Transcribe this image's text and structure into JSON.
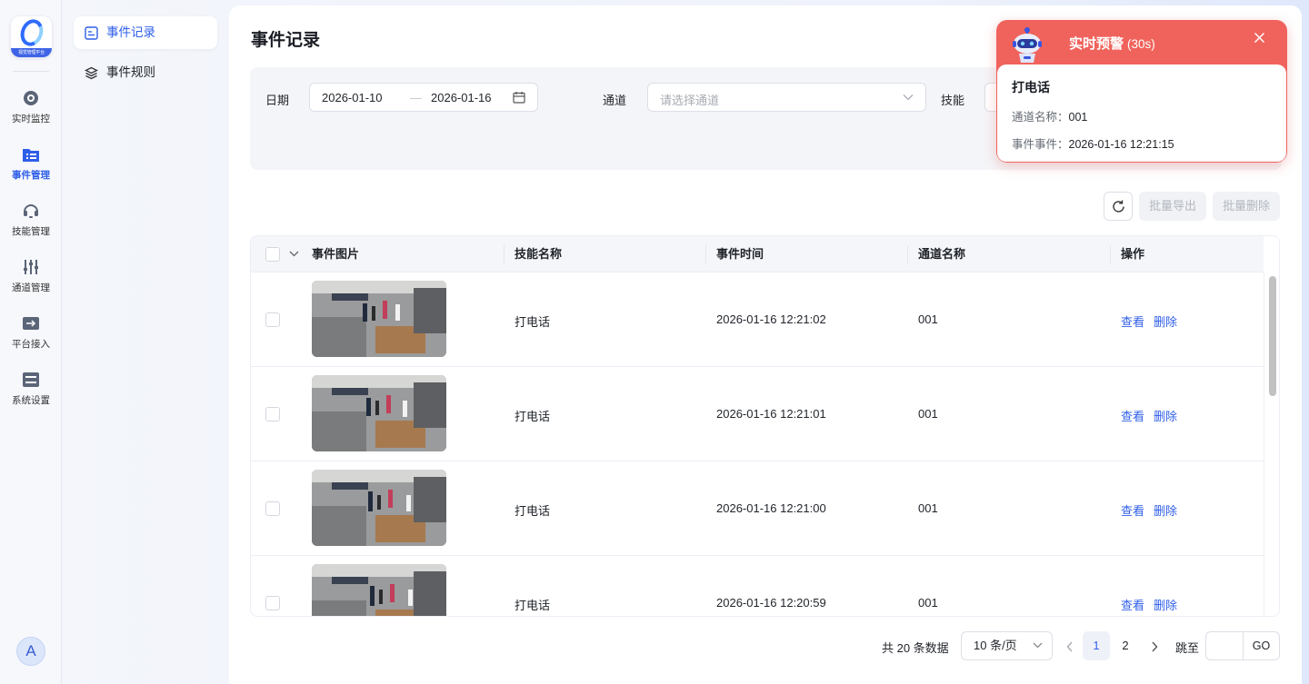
{
  "brand": {
    "logo_caption": "视觉管理平台"
  },
  "rail": [
    {
      "label": "实时监控",
      "icon": "camera-icon",
      "active": false
    },
    {
      "label": "事件管理",
      "icon": "event-list-icon",
      "active": true
    },
    {
      "label": "技能管理",
      "icon": "headset-icon",
      "active": false
    },
    {
      "label": "通道管理",
      "icon": "sliders-icon",
      "active": false
    },
    {
      "label": "平台接入",
      "icon": "access-icon",
      "active": false
    },
    {
      "label": "系统设置",
      "icon": "settings-icon",
      "active": false
    }
  ],
  "user": {
    "avatar_letter": "A"
  },
  "subnav": [
    {
      "label": "事件记录",
      "icon": "record-icon",
      "active": true
    },
    {
      "label": "事件规则",
      "icon": "layers-icon",
      "active": false
    }
  ],
  "page": {
    "title": "事件记录"
  },
  "filters": {
    "date_label": "日期",
    "date_start": "2026-01-10",
    "date_sep": "—",
    "date_end": "2026-01-16",
    "channel_label": "通道",
    "channel_placeholder": "请选择通道",
    "skill_label": "技能"
  },
  "toolbar": {
    "export_label": "批量导出",
    "delete_label": "批量删除"
  },
  "table": {
    "columns": [
      "事件图片",
      "技能名称",
      "事件时间",
      "通道名称",
      "操作"
    ],
    "rows": [
      {
        "skill": "打电话",
        "time": "2026-01-16 12:21:02",
        "channel": "001",
        "view": "查看",
        "delete": "删除"
      },
      {
        "skill": "打电话",
        "time": "2026-01-16 12:21:01",
        "channel": "001",
        "view": "查看",
        "delete": "删除"
      },
      {
        "skill": "打电话",
        "time": "2026-01-16 12:21:00",
        "channel": "001",
        "view": "查看",
        "delete": "删除"
      },
      {
        "skill": "打电话",
        "time": "2026-01-16 12:20:59",
        "channel": "001",
        "view": "查看",
        "delete": "删除"
      }
    ]
  },
  "pagination": {
    "total_text": "共 20 条数据",
    "page_size": "10 条/页",
    "pages": [
      "1",
      "2"
    ],
    "current_page": "1",
    "jump_label": "跳至",
    "go_label": "GO"
  },
  "alert": {
    "title": "实时预警",
    "countdown": "(30s)",
    "event_name": "打电话",
    "channel_key": "通道名称：",
    "channel_value": "001",
    "event_key": "事件事件：",
    "event_value": "2026-01-16 12:21:15",
    "colors": {
      "header": "#f0635c"
    }
  },
  "colors": {
    "accent": "#2f5fe8"
  }
}
